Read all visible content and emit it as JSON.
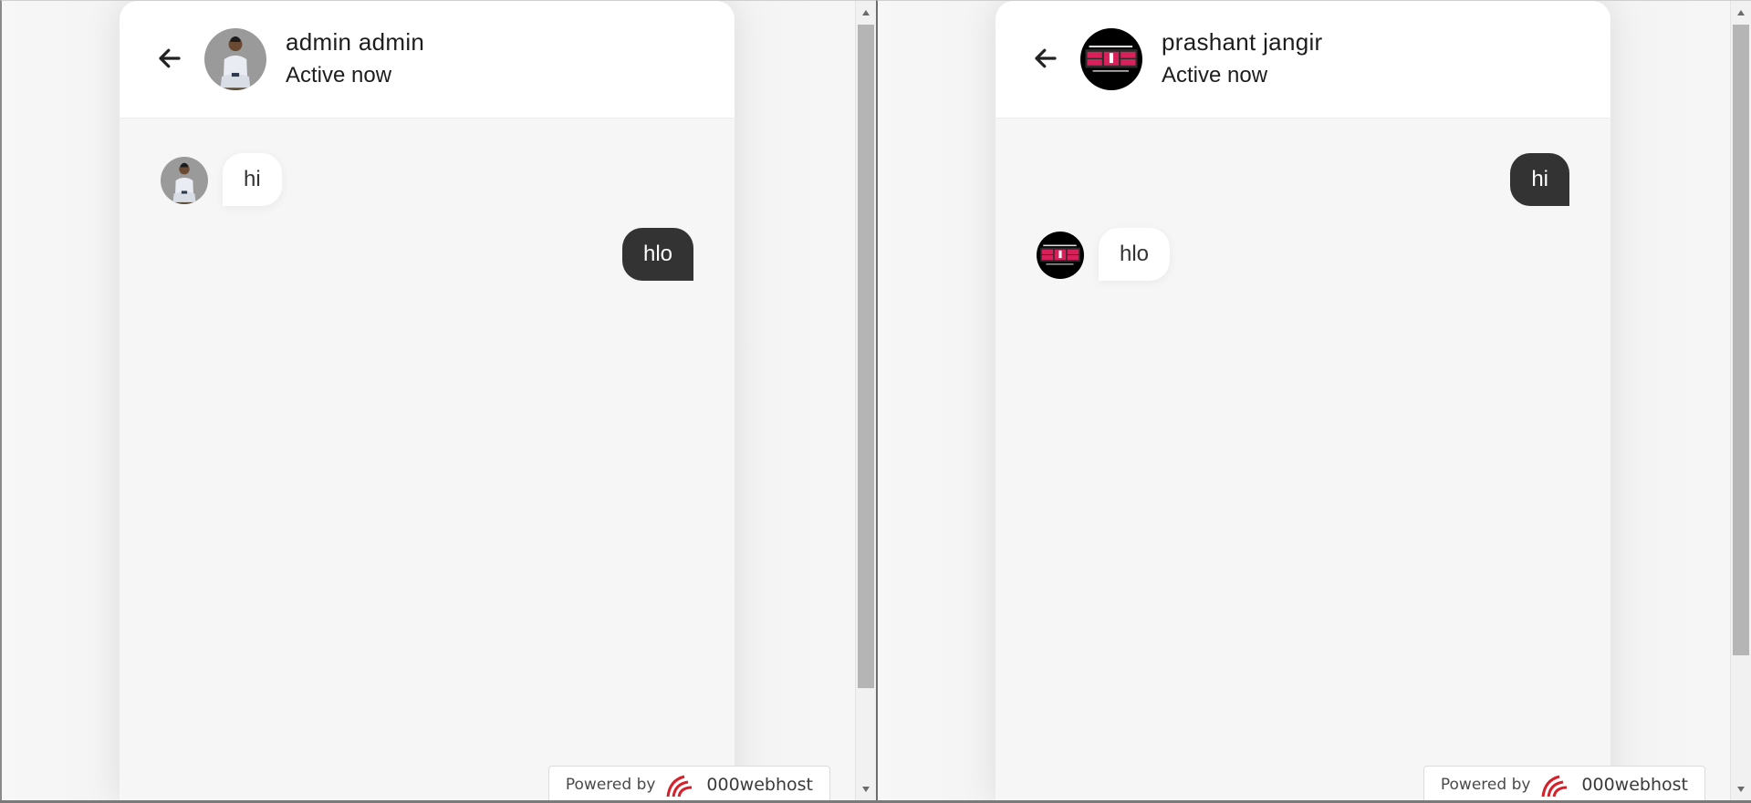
{
  "colors": {
    "outgoing_bubble": "#333333",
    "incoming_bubble": "#ffffff",
    "chat_background": "#f6f6f6",
    "header_background": "#ffffff",
    "brand_accent": "#d8202a"
  },
  "left_window": {
    "header": {
      "back_icon": "arrow-left-icon",
      "avatar": "user-photo-avatar",
      "name": "admin admin",
      "status": "Active now"
    },
    "messages": [
      {
        "direction": "incoming",
        "text": "hi",
        "avatar": "user-photo-avatar"
      },
      {
        "direction": "outgoing",
        "text": "hlo"
      }
    ],
    "footer_badge": {
      "label": "Powered by",
      "brand": "000webhost",
      "logo": "000webhost-logo-icon"
    }
  },
  "right_window": {
    "header": {
      "back_icon": "arrow-left-icon",
      "avatar": "dark-banner-avatar",
      "name": "prashant jangir",
      "status": "Active now"
    },
    "messages": [
      {
        "direction": "outgoing",
        "text": "hi"
      },
      {
        "direction": "incoming",
        "text": "hlo",
        "avatar": "dark-banner-avatar"
      }
    ],
    "footer_badge": {
      "label": "Powered by",
      "brand": "000webhost",
      "logo": "000webhost-logo-icon"
    }
  }
}
